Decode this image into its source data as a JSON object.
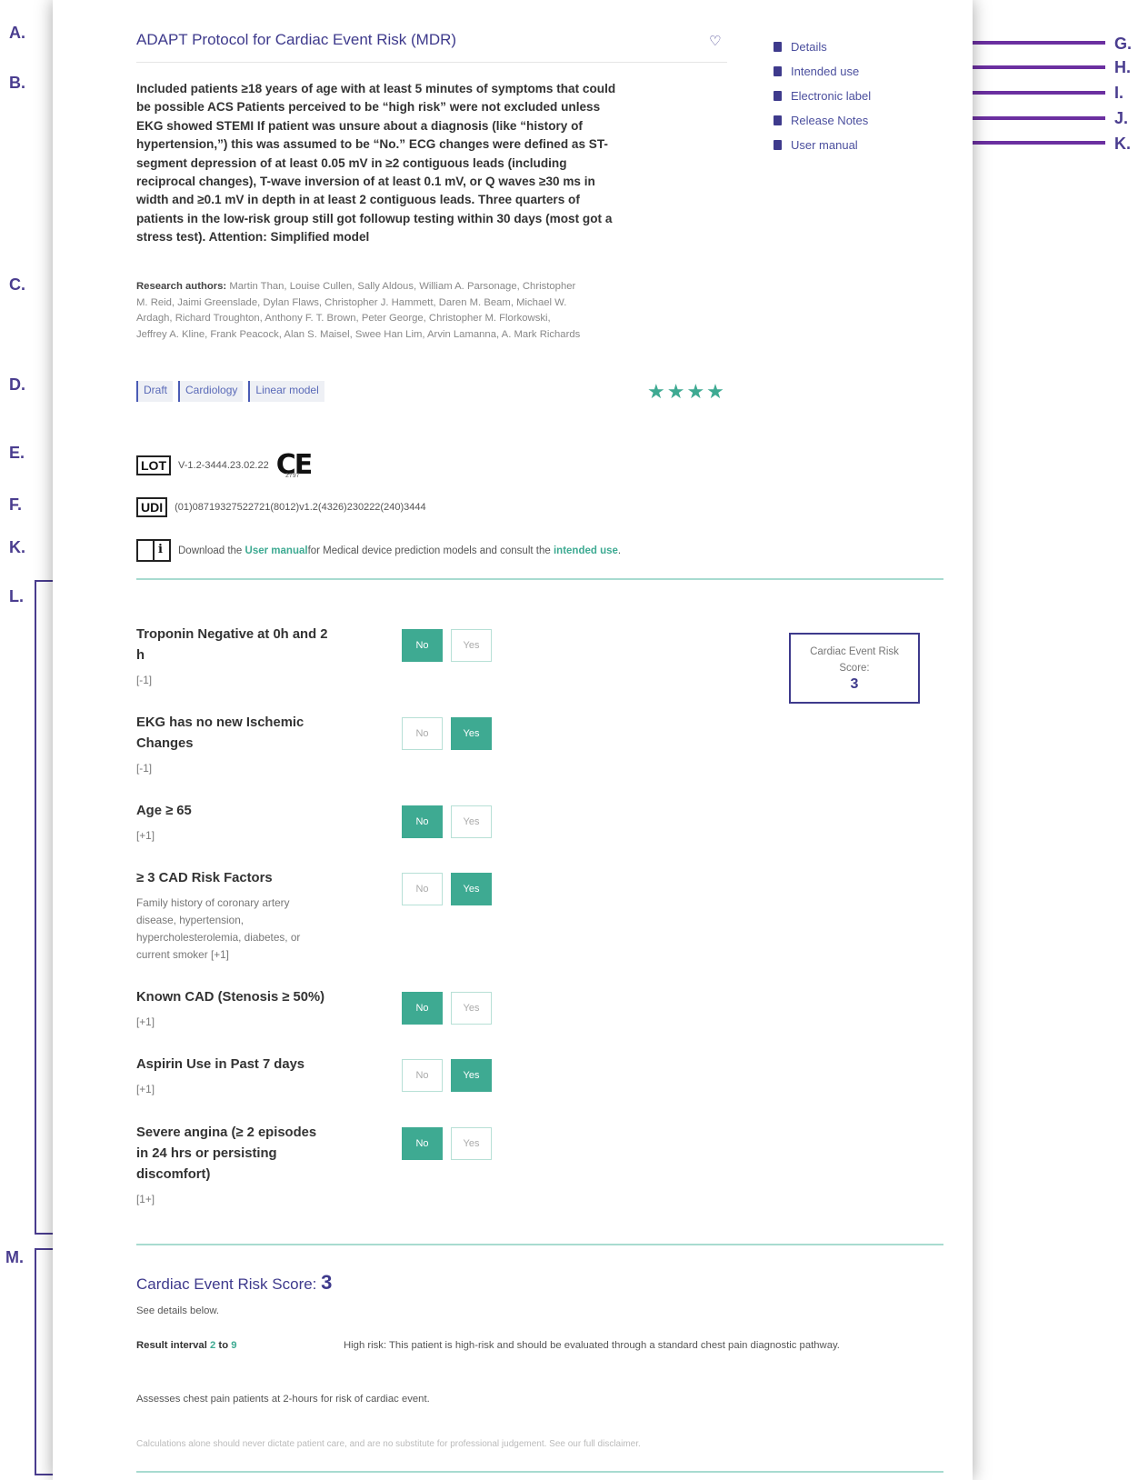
{
  "annotations": {
    "A": "A.",
    "B": "B.",
    "C": "C.",
    "D": "D.",
    "E": "E.",
    "F": "F.",
    "K_left": "K.",
    "L": "L.",
    "M": "M.",
    "G": "G.",
    "H": "H.",
    "I": "I.",
    "J": "J.",
    "K_right": "K."
  },
  "header": {
    "title": "ADAPT Protocol for Cardiac Event Risk (MDR)",
    "favorite_icon": "heart-outline-icon"
  },
  "description": "Included patients ≥18 years of age with at least 5 minutes of symptoms that could be possible ACS Patients perceived to be “high risk” were not excluded unless EKG showed STEMI If patient was unsure about a diagnosis (like “history of hypertension,”) this was assumed to be “No.” ECG changes were defined as ST-segment depression of at least 0.05 mV in ≥2 contiguous leads (including reciprocal changes), T-wave inversion of at least 0.1 mV, or Q waves ≥30 ms in width and ≥0.1 mV in depth in at least 2 contiguous leads. Three quarters of patients in the low-risk group still got followup testing within 30 days (most got a stress test). Attention: Simplified model",
  "authors": {
    "label": "Research authors:",
    "names": "Martin Than, Louise Cullen, Sally Aldous, William A. Parsonage, Christopher M. Reid, Jaimi Greenslade, Dylan Flaws, Christopher J. Hammett, Daren M. Beam, Michael W. Ardagh, Richard Troughton, Anthony F. T. Brown, Peter George, Christopher M. Florkowski, Jeffrey A. Kline, Frank Peacock, Alan S. Maisel, Swee Han Lim, Arvin Lamanna, A. Mark Richards"
  },
  "tags": [
    "Draft",
    "Cardiology",
    "Linear model"
  ],
  "rating": {
    "stars": "★★★★"
  },
  "side_links": [
    {
      "label": "Details",
      "icon": "book-open-icon"
    },
    {
      "label": "Intended use",
      "icon": "document-icon"
    },
    {
      "label": "Electronic label",
      "icon": "document-icon"
    },
    {
      "label": "Release Notes",
      "icon": "document-icon"
    },
    {
      "label": "User manual",
      "icon": "document-icon"
    }
  ],
  "lot": {
    "label": "LOT",
    "value": "V-1.2-3444.23.02.22",
    "ce": "CE",
    "ce_number": "2797"
  },
  "udi": {
    "label": "UDI",
    "value": "(01)08719327522721(8012)v1.2(4326)230222(240)3444"
  },
  "manual": {
    "icon_glyph": "i",
    "prefix": "Download the ",
    "link1": "User manual",
    "middle": " for Medical device prediction models and consult the ",
    "link2": "intended use",
    "suffix": "."
  },
  "questions": [
    {
      "label": "Troponin Negative at 0h and 2 h",
      "sub": "[-1]",
      "no": "No",
      "yes": "Yes",
      "selected": "No"
    },
    {
      "label": "EKG has no new Ischemic Changes",
      "sub": "[-1]",
      "no": "No",
      "yes": "Yes",
      "selected": "Yes"
    },
    {
      "label": "Age ≥ 65",
      "sub": "[+1]",
      "no": "No",
      "yes": "Yes",
      "selected": "No"
    },
    {
      "label": "≥ 3 CAD Risk Factors",
      "sub": "Family history of coronary artery disease, hypertension, hypercholesterolemia, diabetes, or current smoker [+1]",
      "no": "No",
      "yes": "Yes",
      "selected": "Yes"
    },
    {
      "label": "Known CAD (Stenosis ≥ 50%)",
      "sub": "[+1]",
      "no": "No",
      "yes": "Yes",
      "selected": "No"
    },
    {
      "label": "Aspirin Use in Past 7 days",
      "sub": "[+1]",
      "no": "No",
      "yes": "Yes",
      "selected": "Yes"
    },
    {
      "label": "Severe angina (≥ 2 episodes in 24 hrs or persisting discomfort)",
      "sub": "[1+]",
      "no": "No",
      "yes": "Yes",
      "selected": "No"
    }
  ],
  "score_box": {
    "label": "Cardiac Event Risk Score:",
    "value": "3"
  },
  "result": {
    "title": "Cardiac Event Risk Score: ",
    "value": "3",
    "sub": "See details below.",
    "interval_label": "Result interval ",
    "interval_from": "2",
    "interval_to_word": " to ",
    "interval_to": "9",
    "risk_text": "High risk: This patient is high-risk and should be evaluated through a standard chest pain diagnostic pathway.",
    "assess": "Assesses chest pain patients at 2-hours for risk of cardiac event.",
    "disclaimer": "Calculations alone should never dictate patient care, and are no substitute for professional judgement. See our full disclaimer."
  },
  "colors": {
    "accent": "#3e3a8c",
    "teal": "#3eaa92",
    "annotation": "#4a3d8f"
  }
}
